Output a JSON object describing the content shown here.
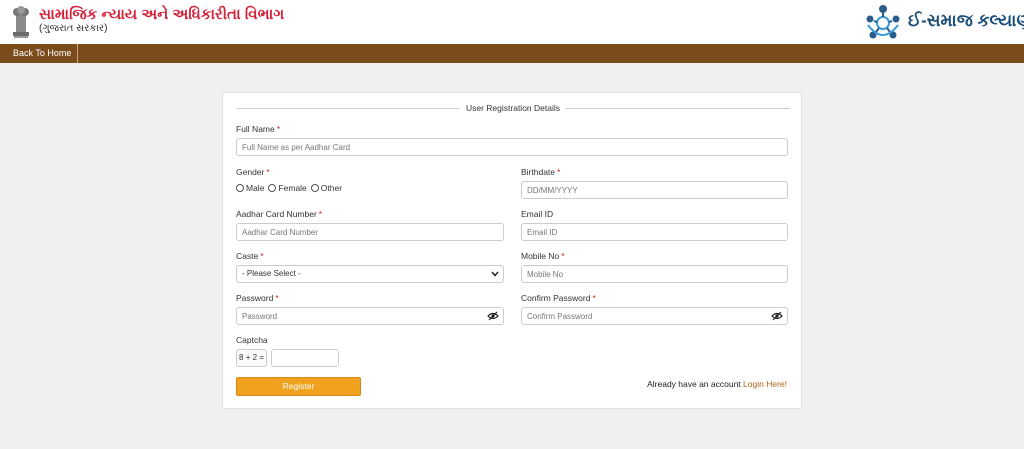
{
  "header": {
    "dept_title": "સામાજિક ન્યાય અને અધિકારીતા વિભાગ",
    "dept_subtitle": "(ગુજરાત સરકાર)",
    "brand_text": "ઈ-સમાજ કલ્યાણ"
  },
  "nav": {
    "back_home": "Back To Home"
  },
  "colors": {
    "header_red": "#d4223b",
    "nav_brown": "#7a4b1b",
    "button_orange": "#f0a21f",
    "brand_blue": "#1d4f7a"
  },
  "form": {
    "legend": "User Registration Details",
    "full_name": {
      "label": "Full Name",
      "placeholder": "Full Name as per Aadhar Card"
    },
    "gender": {
      "label": "Gender",
      "options": [
        "Male",
        "Female",
        "Other"
      ]
    },
    "birthdate": {
      "label": "Birthdate",
      "placeholder": "DD/MM/YYYY"
    },
    "aadhar": {
      "label": "Aadhar Card Number",
      "placeholder": "Aadhar Card Number"
    },
    "email": {
      "label": "Email ID",
      "placeholder": "Email ID"
    },
    "caste": {
      "label": "Caste",
      "selected": "- Please Select -"
    },
    "mobile": {
      "label": "Mobile No",
      "placeholder": "Mobile No"
    },
    "password": {
      "label": "Password",
      "placeholder": "Password"
    },
    "confirm_password": {
      "label": "Confirm Password",
      "placeholder": "Confirm Password"
    },
    "captcha": {
      "label": "Captcha",
      "question": "8 + 2 ="
    },
    "required_mark": "*",
    "register_label": "Register",
    "already_text": "Already have an account",
    "login_link": "Login Here!"
  }
}
